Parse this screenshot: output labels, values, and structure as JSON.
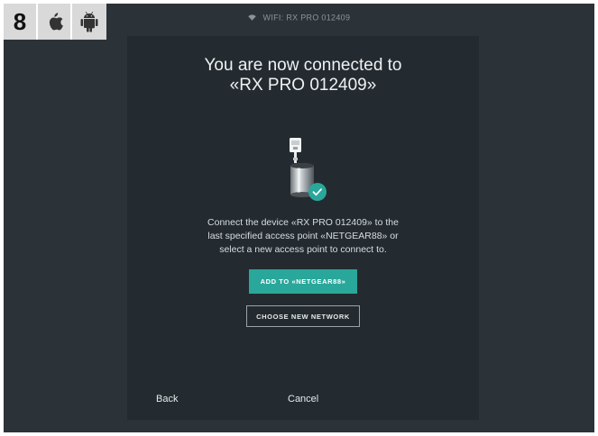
{
  "step_badge": {
    "number": "8",
    "platforms": [
      "apple-icon",
      "android-icon"
    ]
  },
  "status_bar": {
    "icon": "wifi-icon",
    "text": "WIFI: RX PRO 012409"
  },
  "dialog": {
    "title_line1": "You are now connected to",
    "title_line2": "«RX PRO 012409»",
    "device_image": "rx-pro-device-with-check",
    "description_line1": "Connect the device «RX PRO 012409» to the",
    "description_line2": "last specified access point «NETGEAR88» or",
    "description_line3": "select a new access point to connect to.",
    "primary_button": "ADD TO «NETGEAR88»",
    "secondary_button": "CHOOSE NEW NETWORK",
    "back_label": "Back",
    "cancel_label": "Cancel"
  },
  "colors": {
    "background": "#2c3338",
    "panel": "#242b30",
    "accent": "#2aa79b"
  }
}
